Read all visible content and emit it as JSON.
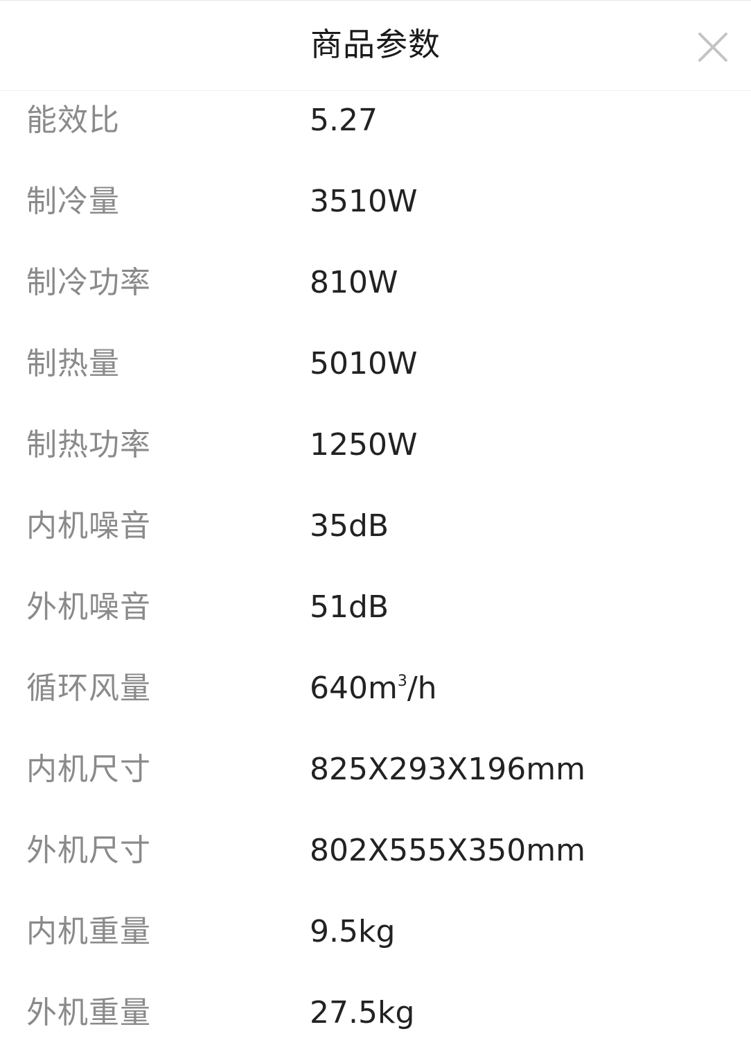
{
  "dialog": {
    "title": "商品参数",
    "close_icon": "close-icon"
  },
  "params": [
    {
      "label": "能效比",
      "value": "5.27"
    },
    {
      "label": "制冷量",
      "value": "3510W"
    },
    {
      "label": "制冷功率",
      "value": "810W"
    },
    {
      "label": "制热量",
      "value": "5010W"
    },
    {
      "label": "制热功率",
      "value": "1250W"
    },
    {
      "label": "内机噪音",
      "value": "35dB"
    },
    {
      "label": "外机噪音",
      "value": "51dB"
    },
    {
      "label": "循环风量",
      "value": "640m",
      "value_sup": "3",
      "value_suffix": "/h"
    },
    {
      "label": "内机尺寸",
      "value": "825X293X196mm"
    },
    {
      "label": "外机尺寸",
      "value": "802X555X350mm"
    },
    {
      "label": "内机重量",
      "value": "9.5kg"
    },
    {
      "label": "外机重量",
      "value": "27.5kg"
    }
  ]
}
